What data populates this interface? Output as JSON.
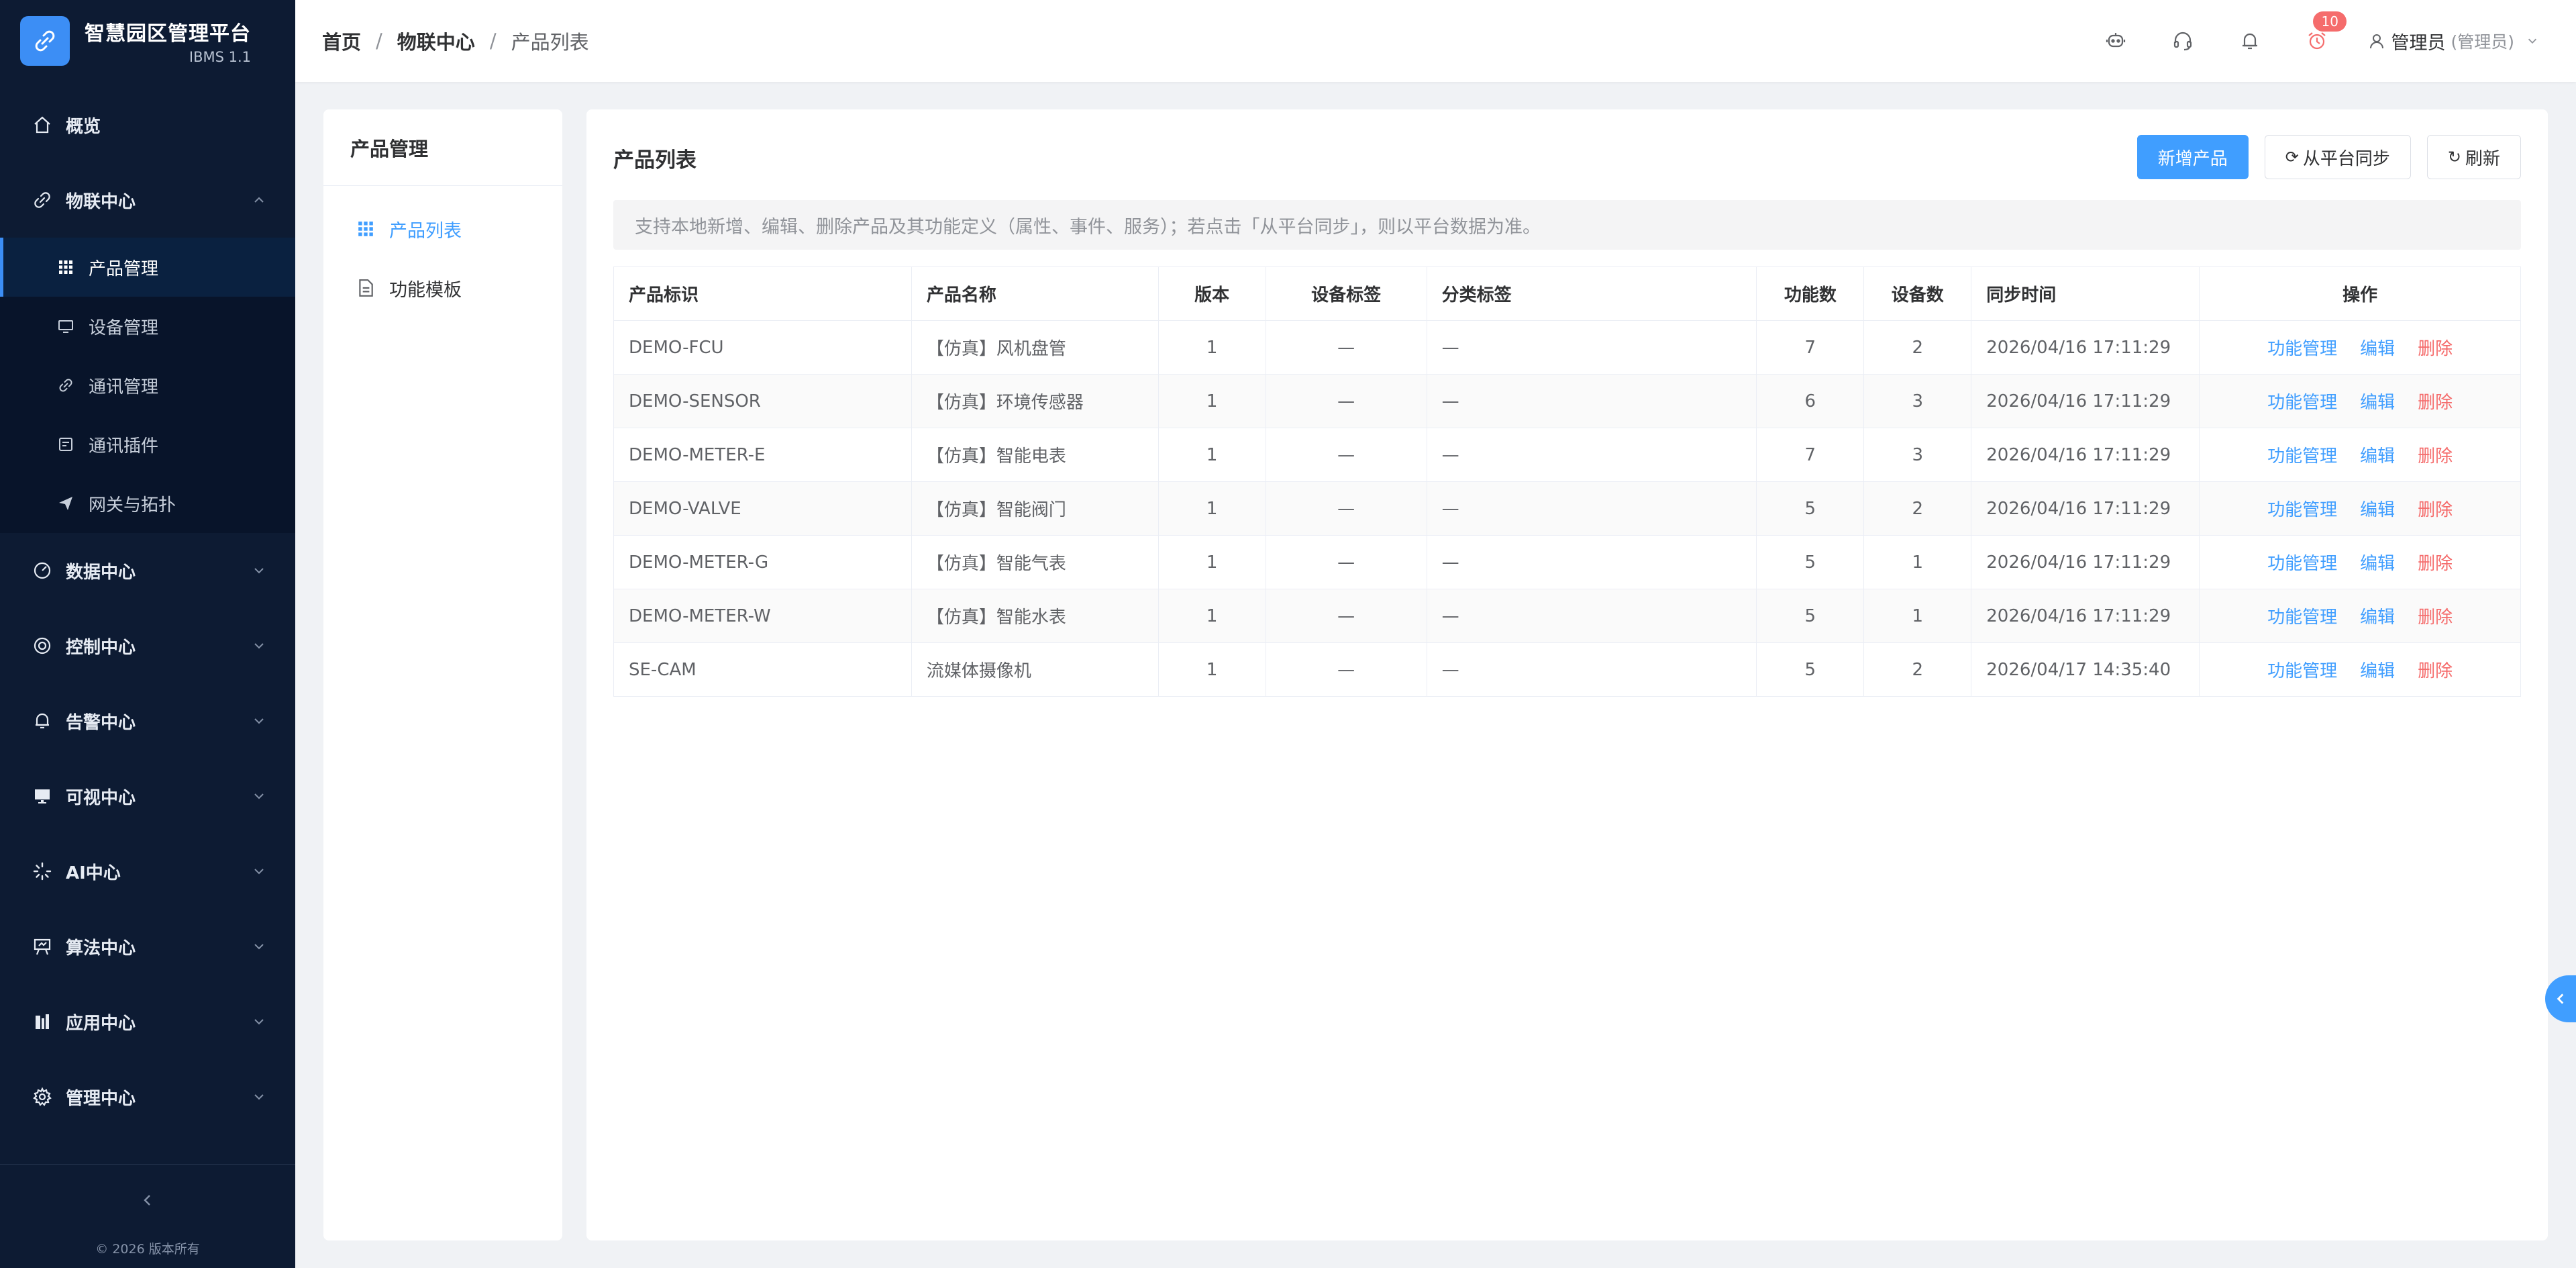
{
  "brand": {
    "title": "智慧园区管理平台",
    "subtitle": "IBMS 1.1"
  },
  "sidebar": {
    "items": [
      {
        "label": "概览",
        "icon": "home-icon"
      },
      {
        "label": "物联中心",
        "icon": "link-icon",
        "expanded": true,
        "children": [
          {
            "label": "产品管理",
            "icon": "grid-icon",
            "active": true
          },
          {
            "label": "设备管理",
            "icon": "monitor-icon"
          },
          {
            "label": "通讯管理",
            "icon": "link-icon"
          },
          {
            "label": "通讯插件",
            "icon": "plugin-icon"
          },
          {
            "label": "网关与拓扑",
            "icon": "send-icon"
          }
        ]
      },
      {
        "label": "数据中心",
        "icon": "gauge-icon"
      },
      {
        "label": "控制中心",
        "icon": "target-icon"
      },
      {
        "label": "告警中心",
        "icon": "bell-icon"
      },
      {
        "label": "可视中心",
        "icon": "screen-icon"
      },
      {
        "label": "AI中心",
        "icon": "loading-icon"
      },
      {
        "label": "算法中心",
        "icon": "easel-icon"
      },
      {
        "label": "应用中心",
        "icon": "building-icon"
      },
      {
        "label": "管理中心",
        "icon": "gear-icon"
      }
    ],
    "copyright": "© 2026 版本所有"
  },
  "header": {
    "breadcrumb": [
      "首页",
      "物联中心",
      "产品列表"
    ],
    "alarm_badge": "10",
    "user_name": "管理员",
    "user_role": "(管理员)"
  },
  "left_panel": {
    "title": "产品管理",
    "items": [
      {
        "label": "产品列表",
        "icon": "grid-icon",
        "active": true
      },
      {
        "label": "功能模板",
        "icon": "document-icon"
      }
    ]
  },
  "main": {
    "title": "产品列表",
    "buttons": {
      "add": "新增产品",
      "sync": "从平台同步",
      "refresh": "刷新"
    },
    "notice": "支持本地新增、编辑、删除产品及其功能定义（属性、事件、服务）；若点击「从平台同步」，则以平台数据为准。",
    "columns": [
      "产品标识",
      "产品名称",
      "版本",
      "设备标签",
      "分类标签",
      "功能数",
      "设备数",
      "同步时间",
      "操作"
    ],
    "rows": [
      {
        "id": "DEMO-FCU",
        "name": "【仿真】风机盘管",
        "version": "1",
        "device_tag": "—",
        "category_tag": "—",
        "features": "7",
        "devices": "2",
        "sync_time": "2026/04/16 17:11:29"
      },
      {
        "id": "DEMO-SENSOR",
        "name": "【仿真】环境传感器",
        "version": "1",
        "device_tag": "—",
        "category_tag": "—",
        "features": "6",
        "devices": "3",
        "sync_time": "2026/04/16 17:11:29"
      },
      {
        "id": "DEMO-METER-E",
        "name": "【仿真】智能电表",
        "version": "1",
        "device_tag": "—",
        "category_tag": "—",
        "features": "7",
        "devices": "3",
        "sync_time": "2026/04/16 17:11:29"
      },
      {
        "id": "DEMO-VALVE",
        "name": "【仿真】智能阀门",
        "version": "1",
        "device_tag": "—",
        "category_tag": "—",
        "features": "5",
        "devices": "2",
        "sync_time": "2026/04/16 17:11:29"
      },
      {
        "id": "DEMO-METER-G",
        "name": "【仿真】智能气表",
        "version": "1",
        "device_tag": "—",
        "category_tag": "—",
        "features": "5",
        "devices": "1",
        "sync_time": "2026/04/16 17:11:29"
      },
      {
        "id": "DEMO-METER-W",
        "name": "【仿真】智能水表",
        "version": "1",
        "device_tag": "—",
        "category_tag": "—",
        "features": "5",
        "devices": "1",
        "sync_time": "2026/04/16 17:11:29"
      },
      {
        "id": "SE-CAM",
        "name": "流媒体摄像机",
        "version": "1",
        "device_tag": "—",
        "category_tag": "—",
        "features": "5",
        "devices": "2",
        "sync_time": "2026/04/17 14:35:40"
      }
    ],
    "row_actions": {
      "manage": "功能管理",
      "edit": "编辑",
      "delete": "删除"
    }
  },
  "colors": {
    "sidebar_bg": "#0d1b33",
    "primary": "#409eff",
    "danger": "#f56c6c"
  }
}
